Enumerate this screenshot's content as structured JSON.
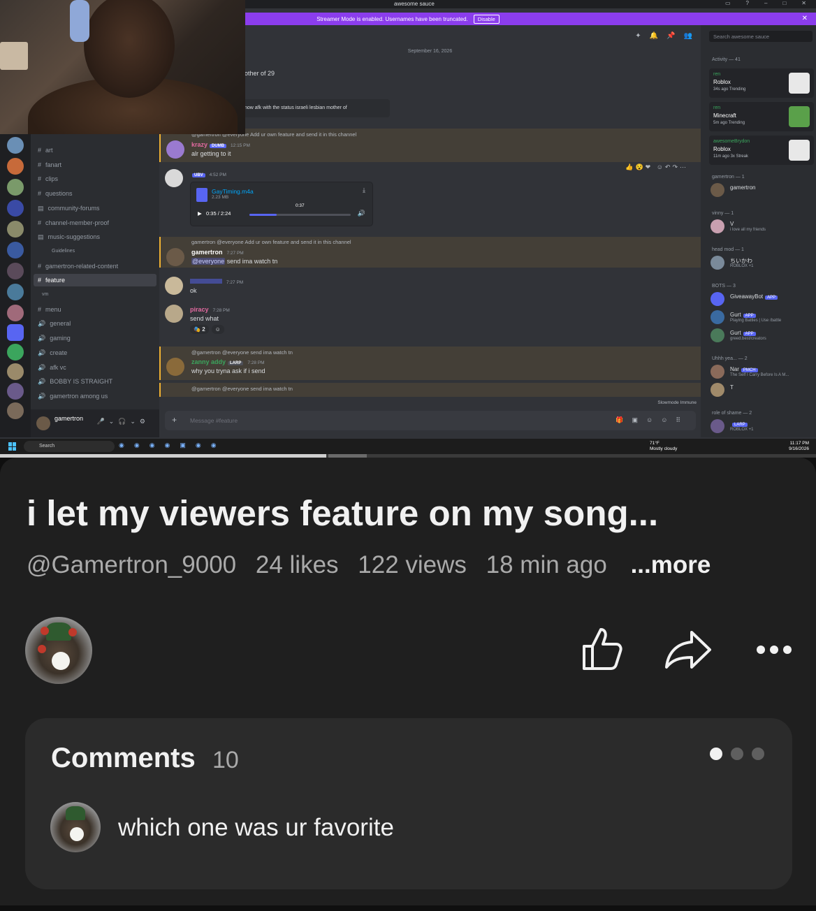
{
  "video_frame": {
    "discord": {
      "window_title": "awesome sauce",
      "streamer_banner": "Streamer Mode is enabled. Usernames have been truncated.",
      "streamer_disable": "Disable",
      "search_placeholder": "Search awesome sauce",
      "date_divider": "September 16, 2026",
      "partial_top_text": "other of 29",
      "status_text": "now afk with the status israeli lesbian mother of",
      "channels": [
        {
          "icon": "#",
          "label": "art"
        },
        {
          "icon": "#",
          "label": "fanart"
        },
        {
          "icon": "#",
          "label": "clips"
        },
        {
          "icon": "#",
          "label": "questions"
        },
        {
          "icon": "forum",
          "label": "community-forums"
        },
        {
          "icon": "#",
          "label": "channel-member-proof"
        },
        {
          "icon": "forum",
          "label": "music-suggestions"
        },
        {
          "icon": "",
          "label": "Guidelines"
        },
        {
          "icon": "#",
          "label": "gamertron-related-content"
        },
        {
          "icon": "#",
          "label": "feature"
        },
        {
          "icon": "",
          "label": "vm"
        },
        {
          "icon": "#",
          "label": "menu"
        },
        {
          "icon": "voice",
          "label": "general"
        },
        {
          "icon": "voice",
          "label": "gaming"
        },
        {
          "icon": "voice",
          "label": "create"
        },
        {
          "icon": "voice",
          "label": "afk vc"
        },
        {
          "icon": "voice",
          "label": "BOBBY IS STRAIGHT"
        },
        {
          "icon": "voice",
          "label": "gamertron among us"
        }
      ],
      "user_panel_name": "gamertron",
      "messages": [
        {
          "reply": "@gamertron @everyone Add ur own feature and send it in this channel",
          "author": "krazy",
          "badge": "DUMB",
          "time": "12:15 PM",
          "body": "alr getting to it"
        },
        {
          "author": "UBV",
          "time": "4:52 PM",
          "file_name": "GayTiming.m4a",
          "file_size": "2.23 MB",
          "player_time": "0:35 / 2:24",
          "tooltip": "0:37"
        },
        {
          "reply": "gamertron @everyone Add ur own feature and send it in this channel",
          "author": "gamertron",
          "time": "7:27 PM",
          "body_mention": "@everyone",
          "body": "send ima watch tn"
        },
        {
          "author": "",
          "time": "7:27 PM",
          "body": "ok"
        },
        {
          "author": "piracy",
          "time": "7:28 PM",
          "body": "send what",
          "reaction_count": "2"
        },
        {
          "reply": "@gamertron @everyone send ima watch tn",
          "author": "zanny addy",
          "badge": "LARP",
          "time": "7:28 PM",
          "body": "why you tryna ask if i send"
        },
        {
          "reply": "@gamertron @everyone send ima watch tn"
        }
      ],
      "slowmode": "Slowmode Immune",
      "composer_placeholder": "Message #feature",
      "members": {
        "activity_header": "Activity — 41",
        "activity_cards": [
          {
            "user": "ren",
            "game": "Roblox",
            "meta": "34s ago  Trending"
          },
          {
            "user": "ren",
            "game": "Minecraft",
            "meta": "5m ago  Trending"
          },
          {
            "user": "awesomeBrydon",
            "game": "Roblox",
            "meta": "11m ago  3x Streak"
          }
        ],
        "groups": [
          {
            "header": "gamertron — 1",
            "items": [
              {
                "name": "gamertron",
                "sub": ""
              }
            ]
          },
          {
            "header": "vinny — 1",
            "items": [
              {
                "name": "V",
                "sub": "i love all my friends"
              }
            ]
          },
          {
            "header": "head mod — 1",
            "items": [
              {
                "name": "ちいかわ",
                "sub": "ROBLOX +1"
              }
            ]
          },
          {
            "header": "BOTS — 3",
            "items": [
              {
                "name": "GiveawayBot",
                "sub": "",
                "tag": "APP"
              },
              {
                "name": "Gurt",
                "sub": "Playing Battles | Use /battle",
                "tag": "APP"
              },
              {
                "name": "Gurt",
                "sub": "greed.best/creators",
                "tag": "APP"
              }
            ]
          },
          {
            "header": "Uhhh yea... — 2",
            "items": [
              {
                "name": "Nar",
                "sub": "The Self I Carry Before Is A M...",
                "tag": "PMCH"
              },
              {
                "name": "T",
                "sub": ""
              }
            ]
          },
          {
            "header": "role of shame — 2",
            "items": [
              {
                "name": "",
                "sub": "ROBLOX +1",
                "tag": "LARP"
              }
            ]
          }
        ]
      }
    },
    "taskbar": {
      "search": "Search",
      "temp": "71°F",
      "weather": "Mostly cloudy",
      "time": "11:17 PM",
      "date": "9/16/2026"
    },
    "progress_fraction": 0.4
  },
  "video": {
    "title": "i let my viewers feature on my song...",
    "handle": "@Gamertron_9000",
    "likes": "24 likes",
    "views": "122 views",
    "age": "18 min ago",
    "more": "...more"
  },
  "actions": {
    "icons": [
      "like-icon",
      "share-icon",
      "more-icon"
    ]
  },
  "comments": {
    "heading": "Comments",
    "count": "10",
    "top_comment": "which one was ur favorite"
  },
  "colors": {
    "background": "#0f0f0f",
    "panel": "#1f1f1f",
    "comments_card": "#2b2b2b",
    "streamer_banner": "#8b3ded"
  }
}
